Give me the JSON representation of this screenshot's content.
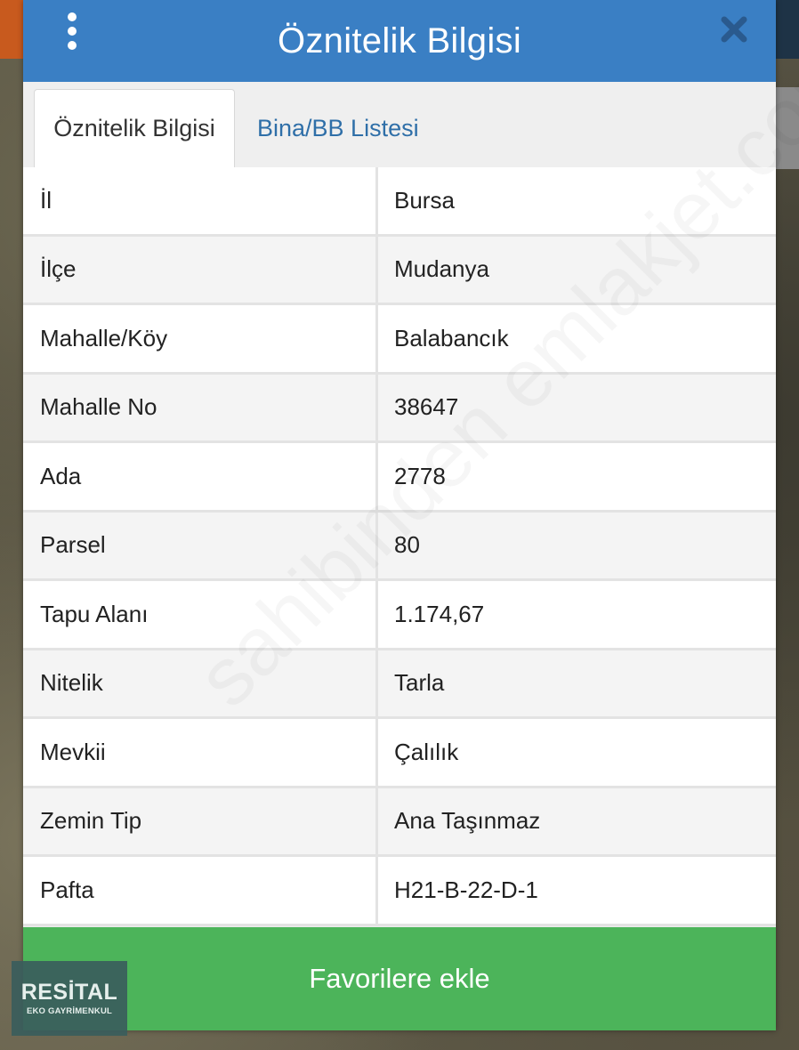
{
  "header": {
    "title": "Öznitelik Bilgisi",
    "menu_icon": "kebab-menu-icon",
    "close_icon": "close-icon"
  },
  "tabs": [
    {
      "label": "Öznitelik Bilgisi",
      "active": true
    },
    {
      "label": "Bina/BB Listesi",
      "active": false
    }
  ],
  "attributes": [
    {
      "key": "İl",
      "value": "Bursa"
    },
    {
      "key": "İlçe",
      "value": "Mudanya"
    },
    {
      "key": "Mahalle/Köy",
      "value": "Balabancık"
    },
    {
      "key": "Mahalle No",
      "value": "38647"
    },
    {
      "key": "Ada",
      "value": "2778"
    },
    {
      "key": "Parsel",
      "value": "80"
    },
    {
      "key": "Tapu Alanı",
      "value": "1.174,67"
    },
    {
      "key": "Nitelik",
      "value": "Tarla"
    },
    {
      "key": "Mevkii",
      "value": "Çalılık"
    },
    {
      "key": "Zemin Tip",
      "value": "Ana Taşınmaz"
    },
    {
      "key": "Pafta",
      "value": "H21-B-22-D-1"
    }
  ],
  "favorite_button": {
    "label": "Favorilere ekle"
  },
  "watermark": "sahibinden emlakjet.com",
  "logo": {
    "name": "RESİTAL",
    "subtitle": "EKO GAYRİMENKUL"
  },
  "colors": {
    "header": "#3a7fc4",
    "tab_link": "#2f6fa8",
    "button": "#4cb45a"
  }
}
